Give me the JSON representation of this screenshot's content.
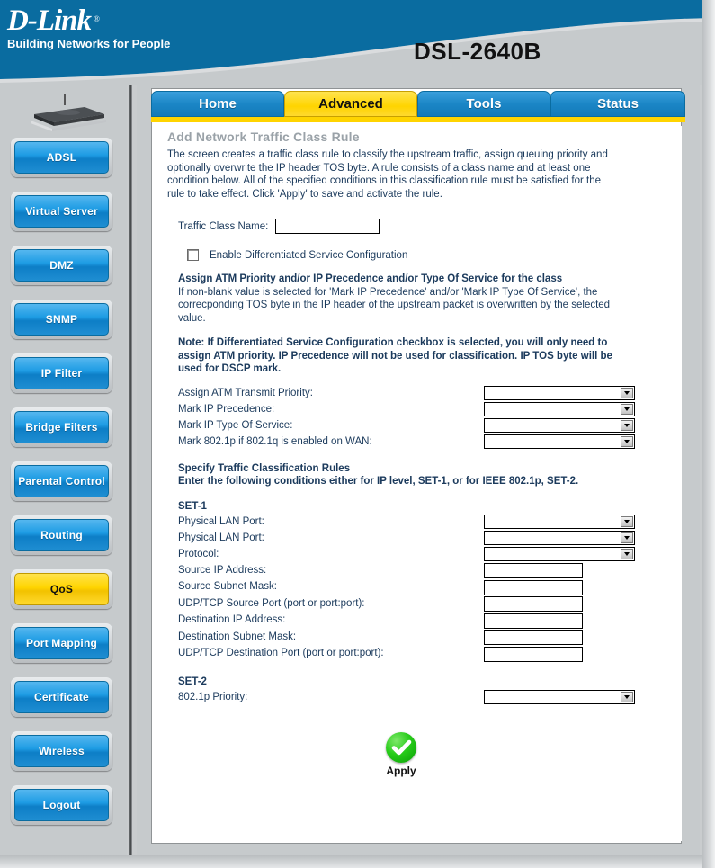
{
  "header": {
    "logo_main": "D-Link",
    "logo_registered": "®",
    "logo_tagline": "Building Networks for People",
    "model": "DSL-2640B",
    "brand_blue": "#0a6ca0",
    "header_gray": "#c6cacc"
  },
  "tabs": [
    {
      "label": "Home",
      "active": false
    },
    {
      "label": "Advanced",
      "active": true
    },
    {
      "label": "Tools",
      "active": false
    },
    {
      "label": "Status",
      "active": false
    }
  ],
  "sidebar": {
    "device_icon": "router-icon",
    "items": [
      {
        "label": "ADSL",
        "active": false
      },
      {
        "label": "Virtual Server",
        "active": false
      },
      {
        "label": "DMZ",
        "active": false
      },
      {
        "label": "SNMP",
        "active": false
      },
      {
        "label": "IP Filter",
        "active": false
      },
      {
        "label": "Bridge Filters",
        "active": false
      },
      {
        "label": "Parental Control",
        "active": false
      },
      {
        "label": "Routing",
        "active": false
      },
      {
        "label": "QoS",
        "active": true
      },
      {
        "label": "Port Mapping",
        "active": false
      },
      {
        "label": "Certificate",
        "active": false
      },
      {
        "label": "Wireless",
        "active": false
      },
      {
        "label": "Logout",
        "active": false
      }
    ],
    "active_color": "#ffd400",
    "button_color": "#1e9ce4"
  },
  "main": {
    "title": "Add Network Traffic Class Rule",
    "description": "The screen creates a traffic class rule to classify the upstream traffic, assign queuing priority and optionally overwrite the IP header TOS byte. A rule consists of a class name and at least one condition below. All of the specified conditions in this classification rule must be satisfied for the rule to take effect. Click 'Apply' to save and activate the rule.",
    "traffic_class_name_label": "Traffic Class Name:",
    "traffic_class_name_value": "",
    "diffserv_checkbox_label": "Enable Differentiated Service Configuration",
    "diffserv_checked": false,
    "assign_heading": "Assign ATM Priority and/or IP Precedence and/or Type Of Service for the class",
    "assign_body": "If non-blank value is selected for 'Mark IP Precedence' and/or 'Mark IP Type Of Service', the correcponding TOS byte in the IP header of the upstream packet is overwritten by the selected value.",
    "note_text": "Note: If Differentiated Service Configuration checkbox is selected, you will only need to assign ATM priority. IP Precedence will not be used for classification. IP TOS byte will be used for DSCP mark.",
    "priority_fields": [
      {
        "label": "Assign ATM Transmit Priority:",
        "value": "",
        "type": "select"
      },
      {
        "label": "Mark IP Precedence:",
        "value": "",
        "type": "select"
      },
      {
        "label": "Mark IP Type Of Service:",
        "value": "",
        "type": "select"
      },
      {
        "label": "Mark 802.1p if 802.1q is enabled on WAN:",
        "value": "",
        "type": "select"
      }
    ],
    "rules_heading": "Specify Traffic Classification Rules",
    "rules_body": "Enter the following conditions either for IP level, SET-1, or for IEEE 802.1p, SET-2.",
    "set1_label": "SET-1",
    "set1_fields": [
      {
        "label": "Physical LAN Port:",
        "value": "",
        "type": "select"
      },
      {
        "label": "Physical LAN Port:",
        "value": "",
        "type": "select"
      },
      {
        "label": "Protocol:",
        "value": "",
        "type": "select"
      },
      {
        "label": "Source IP Address:",
        "value": "",
        "type": "text"
      },
      {
        "label": "Source Subnet Mask:",
        "value": "",
        "type": "text"
      },
      {
        "label": "UDP/TCP Source Port (port or port:port):",
        "value": "",
        "type": "text"
      },
      {
        "label": "Destination IP Address:",
        "value": "",
        "type": "text"
      },
      {
        "label": "Destination Subnet Mask:",
        "value": "",
        "type": "text"
      },
      {
        "label": "UDP/TCP Destination Port (port or port:port):",
        "value": "",
        "type": "text"
      }
    ],
    "set2_label": "SET-2",
    "set2_fields": [
      {
        "label": "802.1p Priority:",
        "value": "",
        "type": "select"
      }
    ],
    "apply_label": "Apply",
    "apply_icon": "green-check-icon"
  }
}
